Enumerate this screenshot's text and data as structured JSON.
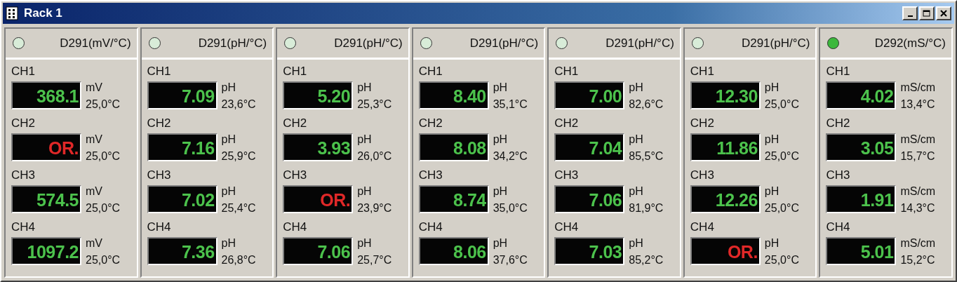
{
  "window": {
    "title": "Rack 1"
  },
  "modules": [
    {
      "name": "D291(mV/°C)",
      "on": false,
      "channels": [
        {
          "label": "CH1",
          "value": "368.1",
          "over_range": false,
          "unit": "mV",
          "temperature": "25,0°C"
        },
        {
          "label": "CH2",
          "value": "OR.",
          "over_range": true,
          "unit": "mV",
          "temperature": "25,0°C"
        },
        {
          "label": "CH3",
          "value": "574.5",
          "over_range": false,
          "unit": "mV",
          "temperature": "25,0°C"
        },
        {
          "label": "CH4",
          "value": "1097.2",
          "over_range": false,
          "unit": "mV",
          "temperature": "25,0°C"
        }
      ]
    },
    {
      "name": "D291(pH/°C)",
      "on": false,
      "channels": [
        {
          "label": "CH1",
          "value": "7.09",
          "over_range": false,
          "unit": "pH",
          "temperature": "23,6°C"
        },
        {
          "label": "CH2",
          "value": "7.16",
          "over_range": false,
          "unit": "pH",
          "temperature": "25,9°C"
        },
        {
          "label": "CH3",
          "value": "7.02",
          "over_range": false,
          "unit": "pH",
          "temperature": "25,4°C"
        },
        {
          "label": "CH4",
          "value": "7.36",
          "over_range": false,
          "unit": "pH",
          "temperature": "26,8°C"
        }
      ]
    },
    {
      "name": "D291(pH/°C)",
      "on": false,
      "channels": [
        {
          "label": "CH1",
          "value": "5.20",
          "over_range": false,
          "unit": "pH",
          "temperature": "25,3°C"
        },
        {
          "label": "CH2",
          "value": "3.93",
          "over_range": false,
          "unit": "pH",
          "temperature": "26,0°C"
        },
        {
          "label": "CH3",
          "value": "OR.",
          "over_range": true,
          "unit": "pH",
          "temperature": "23,9°C"
        },
        {
          "label": "CH4",
          "value": "7.06",
          "over_range": false,
          "unit": "pH",
          "temperature": "25,7°C"
        }
      ]
    },
    {
      "name": "D291(pH/°C)",
      "on": false,
      "channels": [
        {
          "label": "CH1",
          "value": "8.40",
          "over_range": false,
          "unit": "pH",
          "temperature": "35,1°C"
        },
        {
          "label": "CH2",
          "value": "8.08",
          "over_range": false,
          "unit": "pH",
          "temperature": "34,2°C"
        },
        {
          "label": "CH3",
          "value": "8.74",
          "over_range": false,
          "unit": "pH",
          "temperature": "35,0°C"
        },
        {
          "label": "CH4",
          "value": "8.06",
          "over_range": false,
          "unit": "pH",
          "temperature": "37,6°C"
        }
      ]
    },
    {
      "name": "D291(pH/°C)",
      "on": false,
      "channels": [
        {
          "label": "CH1",
          "value": "7.00",
          "over_range": false,
          "unit": "pH",
          "temperature": "82,6°C"
        },
        {
          "label": "CH2",
          "value": "7.04",
          "over_range": false,
          "unit": "pH",
          "temperature": "85,5°C"
        },
        {
          "label": "CH3",
          "value": "7.06",
          "over_range": false,
          "unit": "pH",
          "temperature": "81,9°C"
        },
        {
          "label": "CH4",
          "value": "7.03",
          "over_range": false,
          "unit": "pH",
          "temperature": "85,2°C"
        }
      ]
    },
    {
      "name": "D291(pH/°C)",
      "on": false,
      "channels": [
        {
          "label": "CH1",
          "value": "12.30",
          "over_range": false,
          "unit": "pH",
          "temperature": "25,0°C"
        },
        {
          "label": "CH2",
          "value": "11.86",
          "over_range": false,
          "unit": "pH",
          "temperature": "25,0°C"
        },
        {
          "label": "CH3",
          "value": "12.26",
          "over_range": false,
          "unit": "pH",
          "temperature": "25,0°C"
        },
        {
          "label": "CH4",
          "value": "OR.",
          "over_range": true,
          "unit": "pH",
          "temperature": "25,0°C"
        }
      ]
    },
    {
      "name": "D292(mS/°C)",
      "on": true,
      "channels": [
        {
          "label": "CH1",
          "value": "4.02",
          "over_range": false,
          "unit": "mS/cm",
          "temperature": "13,4°C"
        },
        {
          "label": "CH2",
          "value": "3.05",
          "over_range": false,
          "unit": "mS/cm",
          "temperature": "15,7°C"
        },
        {
          "label": "CH3",
          "value": "1.91",
          "over_range": false,
          "unit": "mS/cm",
          "temperature": "14,3°C"
        },
        {
          "label": "CH4",
          "value": "5.01",
          "over_range": false,
          "unit": "mS/cm",
          "temperature": "15,2°C"
        }
      ]
    }
  ]
}
